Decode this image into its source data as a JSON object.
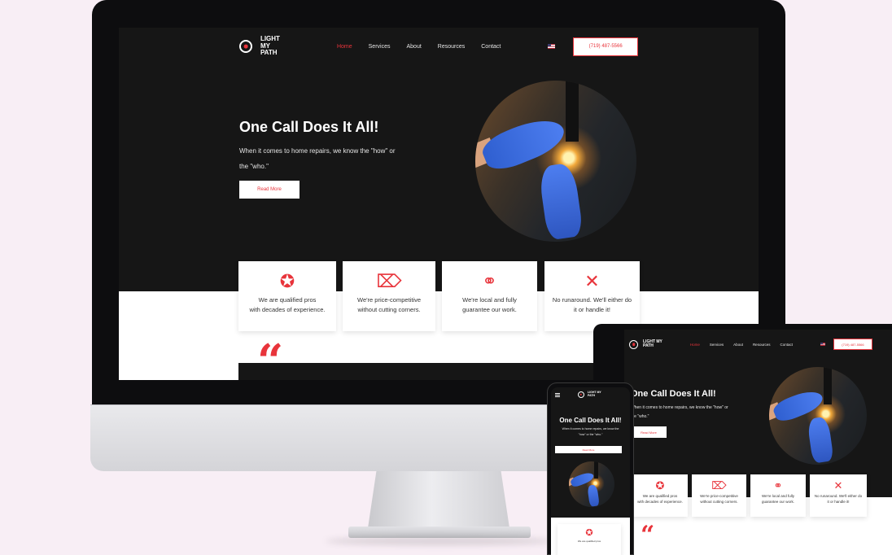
{
  "site": {
    "logo_line1": "LIGHT MY",
    "logo_line2": "PATH",
    "nav": [
      "Home",
      "Services",
      "About",
      "Resources",
      "Contact"
    ],
    "phone": "(719) 487-5566",
    "hero_title": "One Call Does It All!",
    "hero_sub_desktop_line1": "When it comes to home repairs, we know the \"how\" or",
    "hero_sub_desktop_line2": "the \"who.\"",
    "hero_sub_tablet_line1": "When it comes to home repairs, we know the \"how\" or",
    "hero_sub_tablet_line2": "the \"who.\"",
    "hero_sub_mobile_line1": "When it comes to home repairs, we know the",
    "hero_sub_mobile_line2": "\"how\" or the \"who.\"",
    "read_more": "Read More",
    "features": [
      {
        "icon": "award-ribbon-icon",
        "glyph": "✪",
        "line1": "We are qualified pros",
        "line2": "with decades of experience."
      },
      {
        "icon": "price-tag-icon",
        "glyph": "⌦",
        "line1": "We're price-competitive",
        "line2": "without cutting corners."
      },
      {
        "icon": "handshake-icon",
        "glyph": "⚭",
        "line1": "We're local and fully",
        "line2": "guarantee our work."
      },
      {
        "icon": "tools-icon",
        "glyph": "✕",
        "line1": "No runaround. We'll either do",
        "line2": "it or handle it!"
      }
    ],
    "quote_mark": "“"
  },
  "colors": {
    "accent": "#e8343b",
    "background": "#f8eef5",
    "site_dark": "#161616"
  }
}
